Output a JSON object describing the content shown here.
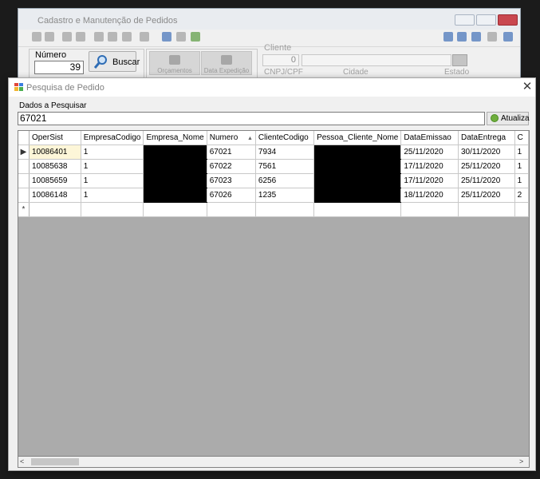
{
  "background_window": {
    "title": "Cadastro e Manutenção de Pedidos",
    "numero_label": "Número",
    "numero_value": "39",
    "buscar_label": "Buscar",
    "orcamentos_label": "Orçamentos",
    "data_expedicao_label": "Data Expedição",
    "cliente_label": "Cliente",
    "cliente_code": "0",
    "cnpj_label": "CNPJ/CPF",
    "cidade_label": "Cidade",
    "estado_label": "Estado"
  },
  "dialog": {
    "title": "Pesquisa de Pedido",
    "close_glyph": "✕",
    "search_label": "Dados a Pesquisar",
    "search_value": "67021",
    "atualiza_label": "Atualiza"
  },
  "grid": {
    "row_indicator": "▶",
    "new_row_indicator": "*",
    "sort_arrow": "▲",
    "columns": [
      "OperSist",
      "EmpresaCodigo",
      "Empresa_Nome",
      "Numero",
      "ClienteCodigo",
      "Pessoa_Cliente_Nome",
      "DataEmissao",
      "DataEntrega",
      "C"
    ],
    "rows": [
      [
        "10086401",
        "1",
        "",
        "67021",
        "7934",
        "",
        "25/11/2020",
        "30/11/2020",
        "1"
      ],
      [
        "10085638",
        "1",
        "",
        "67022",
        "7561",
        "",
        "17/11/2020",
        "25/11/2020",
        "1"
      ],
      [
        "10085659",
        "1",
        "",
        "67023",
        "6256",
        "",
        "17/11/2020",
        "25/11/2020",
        "1"
      ],
      [
        "10086148",
        "1",
        "",
        "67026",
        "1235",
        "",
        "18/11/2020",
        "25/11/2020",
        "2"
      ]
    ]
  },
  "scrollbar": {
    "left_arrow": "<",
    "right_arrow": ">"
  },
  "colors": {
    "grid_empty_area": "#ababab",
    "selected_cell": "#fdf6d8",
    "redaction": "#000000"
  }
}
